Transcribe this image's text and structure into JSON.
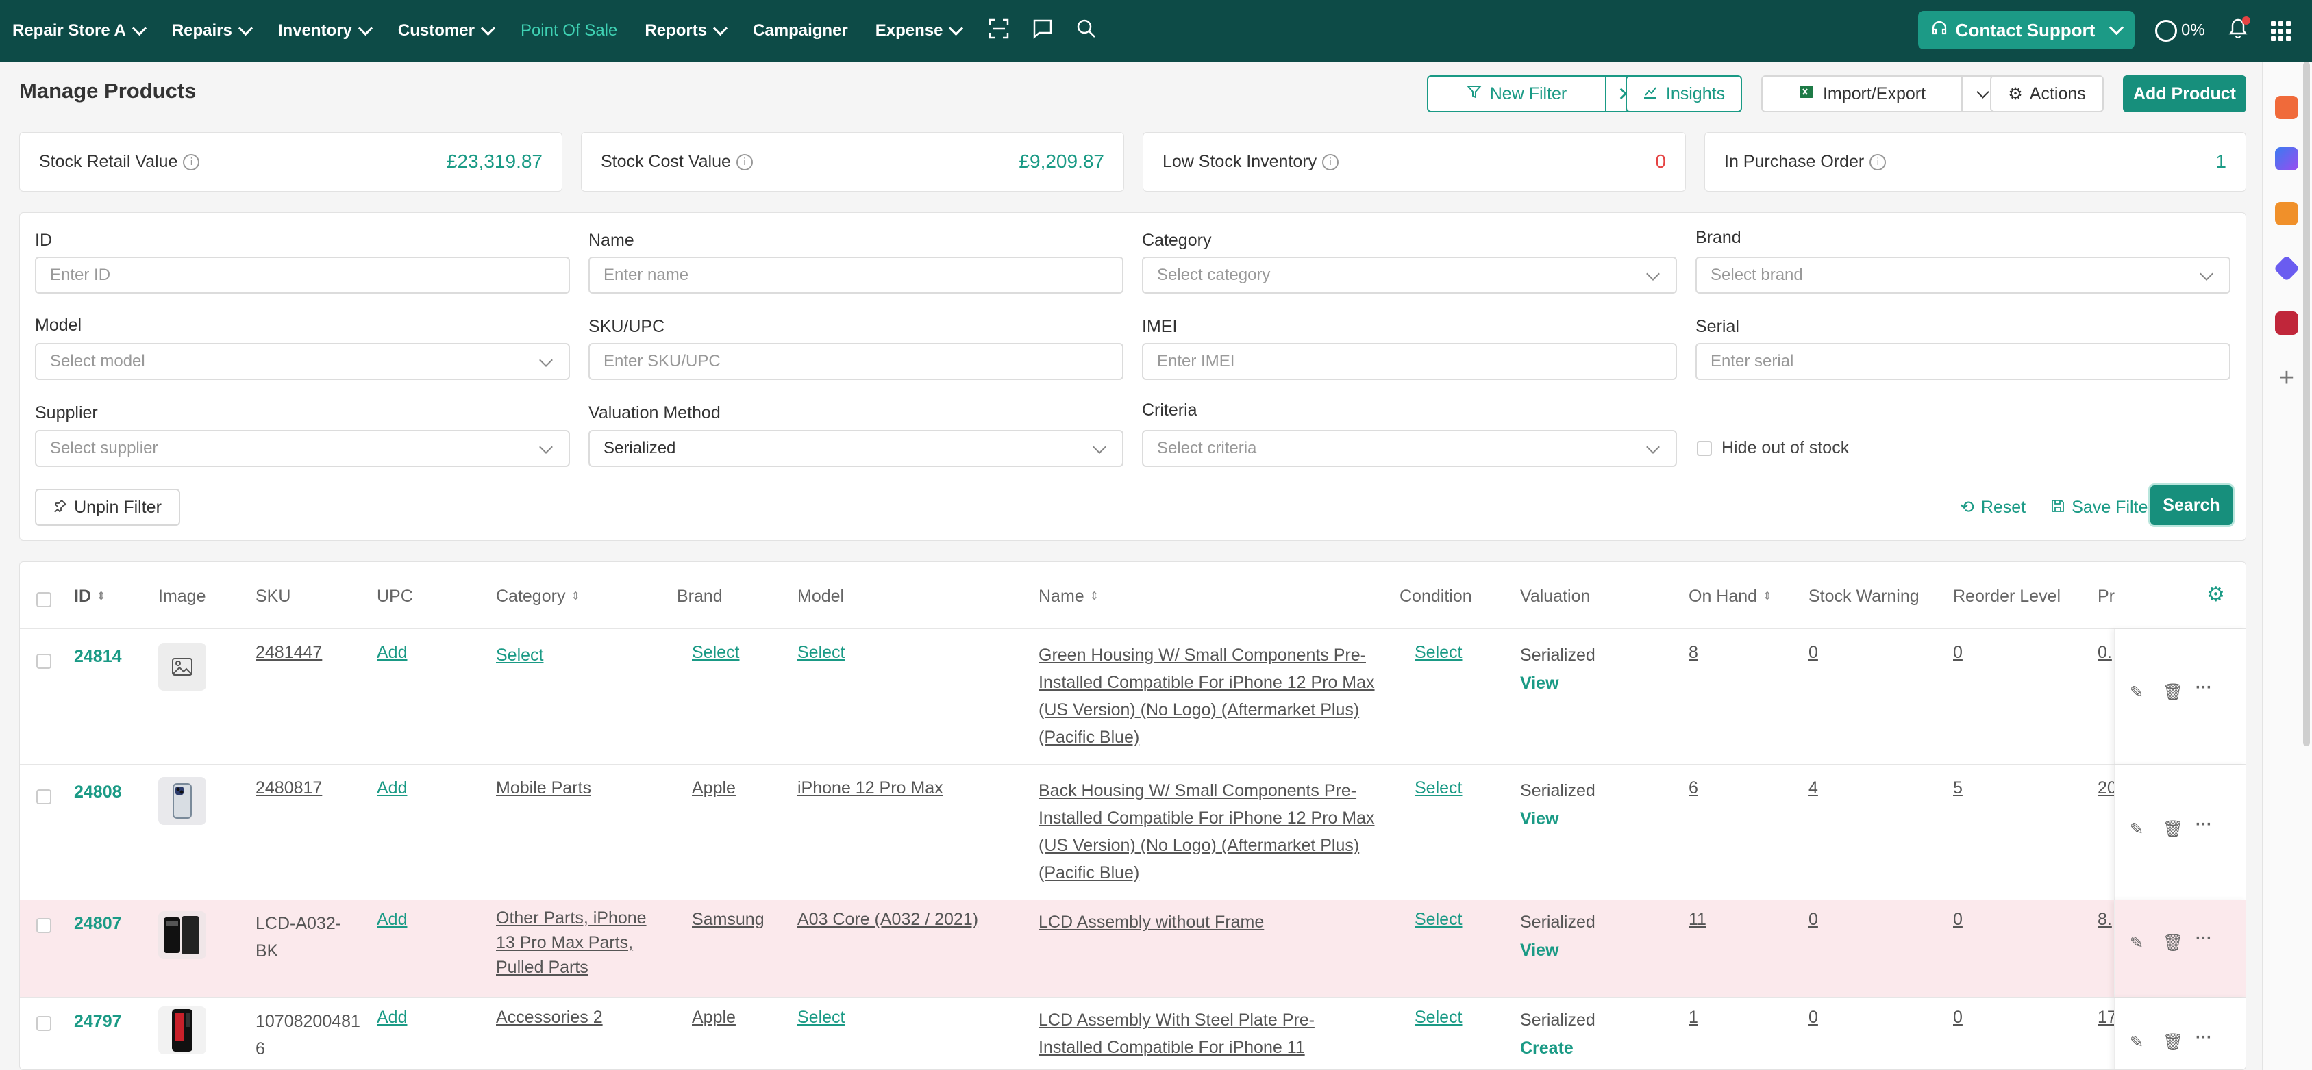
{
  "nav": {
    "store": "Repair Store A",
    "items": [
      {
        "label": "Repairs",
        "dropdown": true
      },
      {
        "label": "Inventory",
        "dropdown": true
      },
      {
        "label": "Customer",
        "dropdown": true
      },
      {
        "label": "Point Of Sale",
        "dropdown": false,
        "active": true
      },
      {
        "label": "Reports",
        "dropdown": true
      },
      {
        "label": "Campaigner",
        "dropdown": false
      },
      {
        "label": "Expense",
        "dropdown": true
      }
    ],
    "contact_support": "Contact Support",
    "progress": "0%"
  },
  "page": {
    "title": "Manage Products",
    "new_filter": "New Filter",
    "insights": "Insights",
    "import_export": "Import/Export",
    "actions": "Actions",
    "add_product": "Add Product"
  },
  "stats": [
    {
      "label": "Stock Retail Value",
      "value": "£23,319.87",
      "color": "#1a9a85"
    },
    {
      "label": "Stock Cost Value",
      "value": "£9,209.87",
      "color": "#1a9a85"
    },
    {
      "label": "Low Stock Inventory",
      "value": "0",
      "color": "#e54343"
    },
    {
      "label": "In Purchase Order",
      "value": "1",
      "color": "#1a9a85"
    }
  ],
  "filters": {
    "id": {
      "label": "ID",
      "placeholder": "Enter ID"
    },
    "name": {
      "label": "Name",
      "placeholder": "Enter name"
    },
    "category": {
      "label": "Category",
      "placeholder": "Select category"
    },
    "brand": {
      "label": "Brand",
      "placeholder": "Select brand"
    },
    "model": {
      "label": "Model",
      "placeholder": "Select model"
    },
    "sku": {
      "label": "SKU/UPC",
      "placeholder": "Enter SKU/UPC"
    },
    "imei": {
      "label": "IMEI",
      "placeholder": "Enter IMEI"
    },
    "serial": {
      "label": "Serial",
      "placeholder": "Enter serial"
    },
    "supplier": {
      "label": "Supplier",
      "placeholder": "Select supplier"
    },
    "valuation": {
      "label": "Valuation Method",
      "value": "Serialized"
    },
    "criteria": {
      "label": "Criteria",
      "placeholder": "Select criteria"
    },
    "hide_out_of_stock": "Hide out of stock",
    "unpin": "Unpin Filter",
    "reset": "Reset",
    "save": "Save Filter",
    "search": "Search"
  },
  "table": {
    "headers": {
      "id": "ID",
      "image": "Image",
      "sku": "SKU",
      "upc": "UPC",
      "category": "Category",
      "brand": "Brand",
      "model": "Model",
      "name": "Name",
      "condition": "Condition",
      "valuation": "Valuation",
      "on_hand": "On Hand",
      "stock_warning": "Stock Warning",
      "reorder_level": "Reorder Level",
      "price": "Pr"
    },
    "rows": [
      {
        "id": "24814",
        "sku": "2481447",
        "upc": "Add",
        "category": "Select",
        "brand": "Select",
        "model": "Select",
        "name_lines": [
          "Green Housing W/ Small Components Pre-",
          "Installed Compatible For iPhone 12 Pro Max",
          "(US Version) (No Logo) (Aftermarket Plus)",
          "(Pacific Blue)"
        ],
        "condition": "Select",
        "valuation": "Serialized",
        "valuation_action": "View",
        "on_hand": "8",
        "stock_warning": "0",
        "reorder_level": "0",
        "price": "0."
      },
      {
        "id": "24808",
        "sku": "2480817",
        "upc": "Add",
        "category": "Mobile Parts",
        "brand": "Apple",
        "model": "iPhone 12 Pro Max",
        "name_lines": [
          "Back Housing W/ Small Components Pre-",
          "Installed Compatible For iPhone 12 Pro Max",
          "(US Version) (No Logo) (Aftermarket Plus)",
          "(Pacific Blue)"
        ],
        "condition": "Select",
        "valuation": "Serialized",
        "valuation_action": "View",
        "on_hand": "6",
        "stock_warning": "4",
        "reorder_level": "5",
        "price": "20"
      },
      {
        "id": "24807",
        "sku_lines": [
          "LCD-A032-",
          "BK"
        ],
        "upc": "Add",
        "category_lines": [
          "Other Parts, iPhone",
          "13 Pro Max Parts,",
          "Pulled Parts"
        ],
        "brand": "Samsung",
        "model": "A03 Core (A032 / 2021)",
        "name_lines": [
          "LCD Assembly without Frame"
        ],
        "condition": "Select",
        "valuation": "Serialized",
        "valuation_action": "View",
        "on_hand": "11",
        "stock_warning": "0",
        "reorder_level": "0",
        "price": "8."
      },
      {
        "id": "24797",
        "sku_lines": [
          "10708200481",
          "6"
        ],
        "upc": "Add",
        "category": "Accessories 2",
        "brand": "Apple",
        "model": "Select",
        "name_lines": [
          "LCD Assembly With Steel Plate Pre-",
          "Installed Compatible For iPhone 11"
        ],
        "condition": "Select",
        "valuation": "Serialized",
        "valuation_action": "Create",
        "on_hand": "1",
        "stock_warning": "0",
        "reorder_level": "0",
        "price": "17"
      }
    ]
  }
}
